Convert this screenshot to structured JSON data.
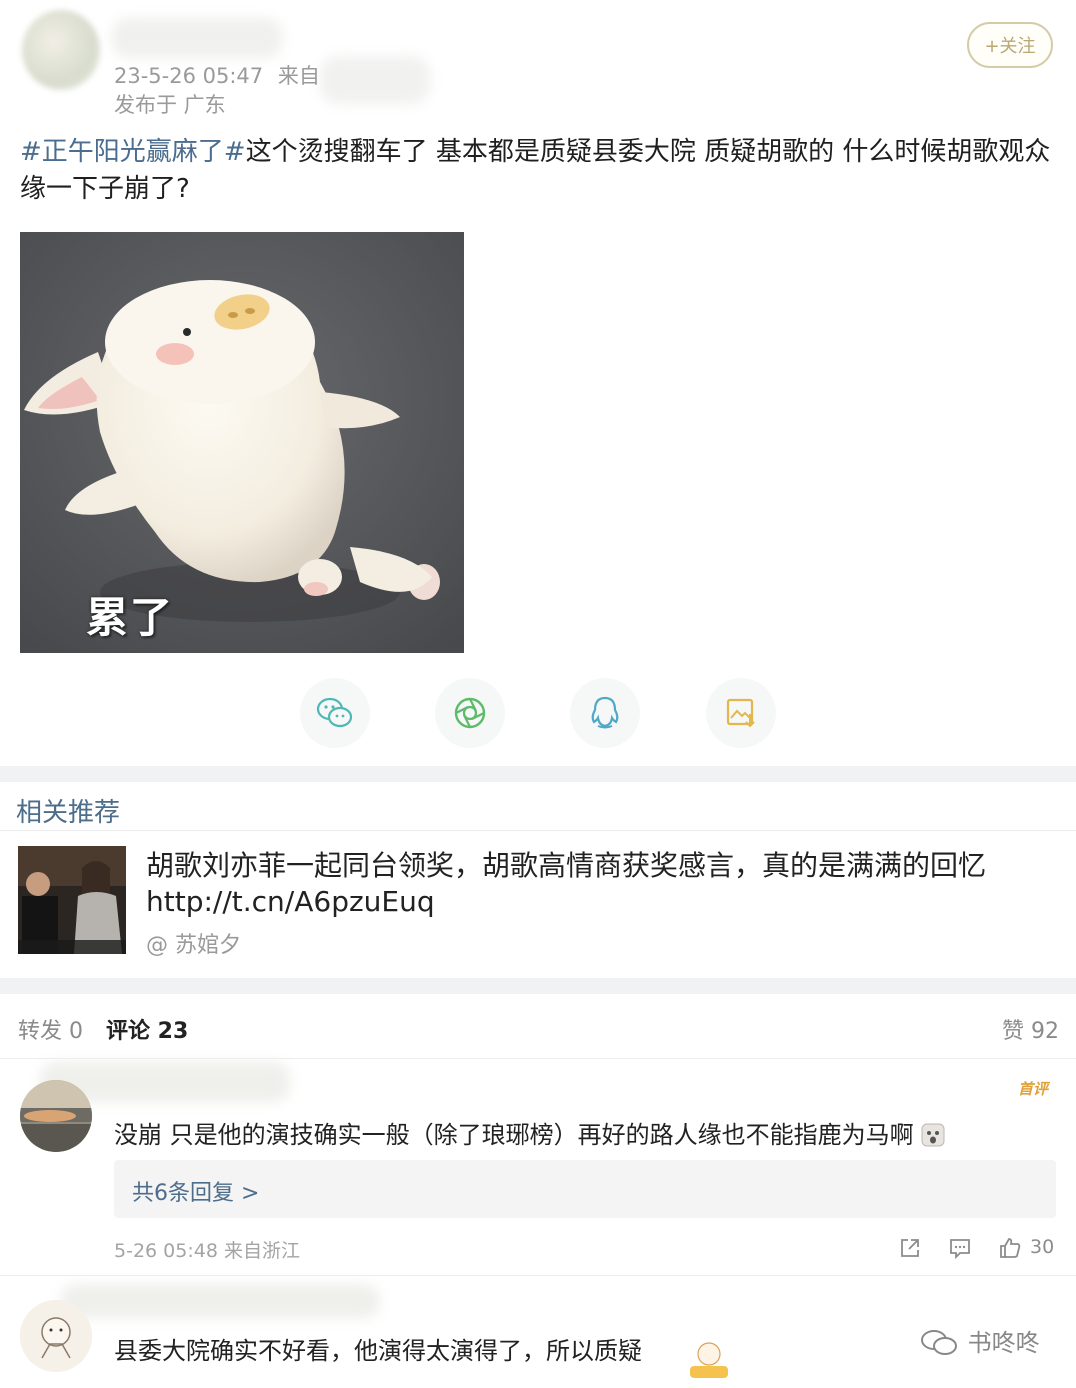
{
  "post": {
    "timestamp": "23-5-26 05:47",
    "source_prefix": "来自",
    "location": "发布于 广东",
    "follow_label": "+关注",
    "hashtag": "#正午阳光赢麻了#",
    "body": "这个烫搜翻车了  基本都是质疑县委大院  质疑胡歌的 什么时候胡歌观众缘一下子崩了?",
    "image_caption": "累了"
  },
  "share_icons": [
    "wechat-icon",
    "moments-icon",
    "qq-icon",
    "save-image-icon"
  ],
  "related": {
    "section_title": "相关推荐",
    "title": "胡歌刘亦菲一起同台领奖，胡歌高情商获奖感言，真的是满满的回忆http://t.cn/A6pzuEuq",
    "author": "@ 苏婠夕"
  },
  "stats": {
    "repost": "转发 0",
    "comments": "评论 23",
    "likes": "赞 92"
  },
  "comments": [
    {
      "badge": "首评",
      "text": "没崩 只是他的演技确实一般（除了琅琊榜）再好的路人缘也不能指鹿为马啊",
      "replies_link": "共6条回复 >",
      "meta": "5-26 05:48 来自浙江",
      "like_count": "30"
    },
    {
      "text": "县委大院确实不好看，他演得太演得了，所以质疑"
    }
  ],
  "watermark": "书咚咚",
  "colors": {
    "link": "#4d6d8b",
    "hashtag": "#4b6d8f",
    "follow": "#b8a874",
    "badge": "#e0a238"
  }
}
